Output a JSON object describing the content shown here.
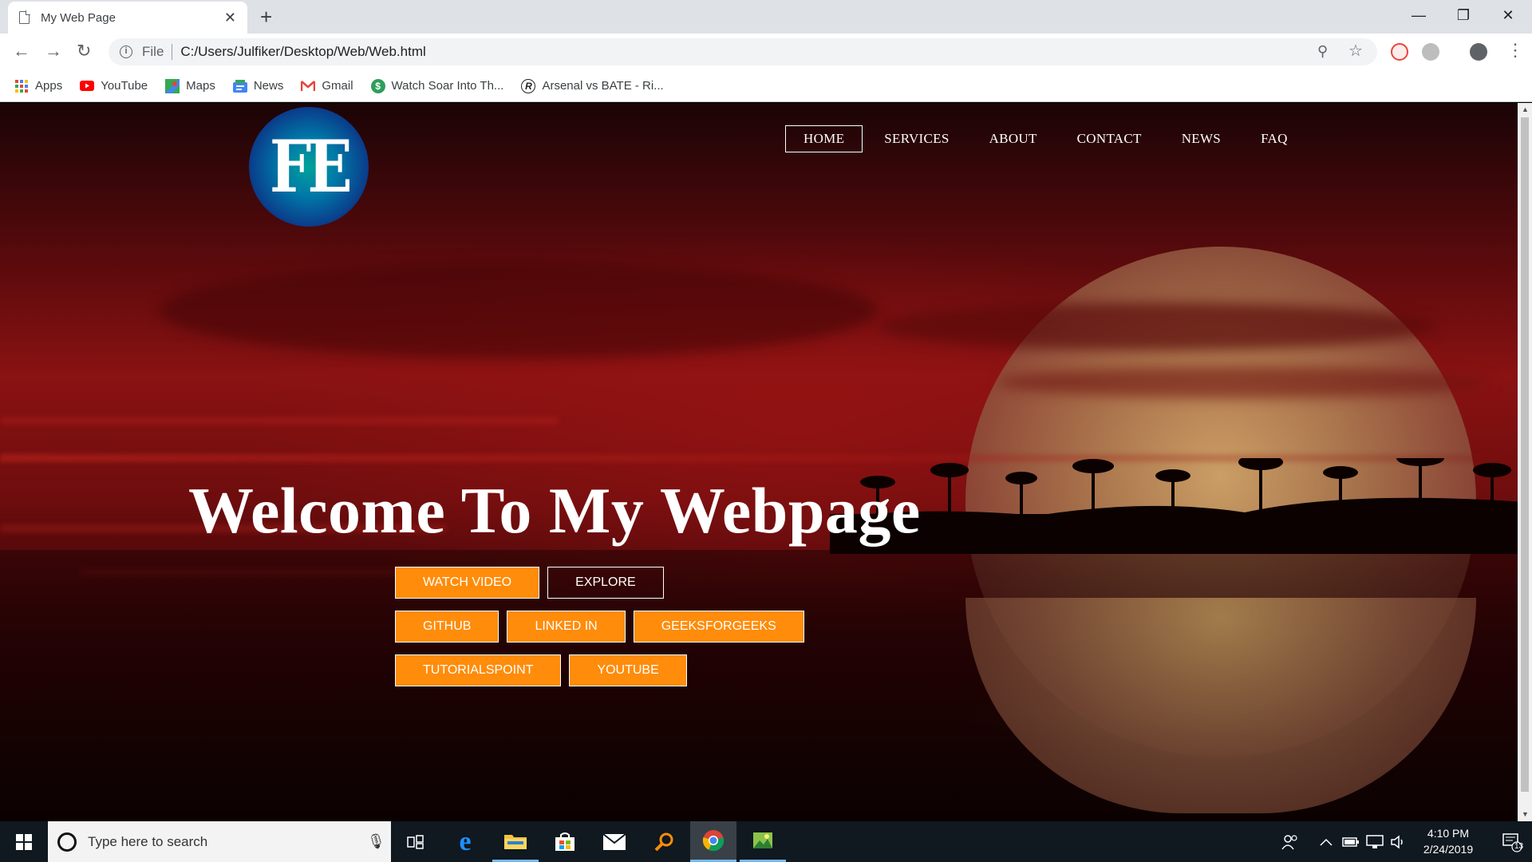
{
  "browser": {
    "tab_title": "My Web Page",
    "tab_close": "✕",
    "new_tab": "+",
    "window_controls": {
      "minimize": "—",
      "maximize": "❐",
      "close": "✕"
    },
    "nav": {
      "back": "←",
      "forward": "→",
      "reload": "↻"
    },
    "address": {
      "scheme_label": "File",
      "url": "C:/Users/Julfiker/Desktop/Web/Web.html"
    },
    "omni_icons": {
      "zoom": "⚲",
      "star": "☆",
      "menu": "⋮"
    },
    "bookmarks": [
      {
        "label": "Apps",
        "icon": "apps-grid-icon"
      },
      {
        "label": "YouTube",
        "icon": "youtube-icon"
      },
      {
        "label": "Maps",
        "icon": "maps-icon"
      },
      {
        "label": "News",
        "icon": "news-icon"
      },
      {
        "label": "Gmail",
        "icon": "gmail-icon"
      },
      {
        "label": "Watch Soar Into Th...",
        "icon": "dollar-circle-icon"
      },
      {
        "label": "Arsenal vs BATE - Ri...",
        "icon": "r-logo-icon"
      }
    ]
  },
  "site": {
    "logo_text": "FE",
    "nav": [
      {
        "label": "HOME",
        "active": true
      },
      {
        "label": "SERVICES",
        "active": false
      },
      {
        "label": "ABOUT",
        "active": false
      },
      {
        "label": "CONTACT",
        "active": false
      },
      {
        "label": "NEWS",
        "active": false
      },
      {
        "label": "FAQ",
        "active": false
      }
    ],
    "hero_title": "Welcome To My Webpage",
    "buttons_row1": [
      "WATCH VIDEO",
      "EXPLORE"
    ],
    "buttons_row2": [
      "GITHUB",
      "LINKED IN",
      "GEEKSFORGEEKS"
    ],
    "buttons_row3": [
      "TUTORIALSPOINT",
      "YOUTUBE"
    ],
    "colors": {
      "button_orange": "#ff8c0a",
      "logo_blue": "#0a3c8a",
      "logo_teal": "#00a29a"
    }
  },
  "taskbar": {
    "search_placeholder": "Type here to search",
    "time": "4:10 PM",
    "date": "2/24/2019",
    "notification_count": "13",
    "apps": [
      "task-view-icon",
      "edge-icon",
      "file-explorer-icon",
      "store-icon",
      "mail-icon",
      "search-app-icon",
      "chrome-icon",
      "image-viewer-icon"
    ]
  }
}
